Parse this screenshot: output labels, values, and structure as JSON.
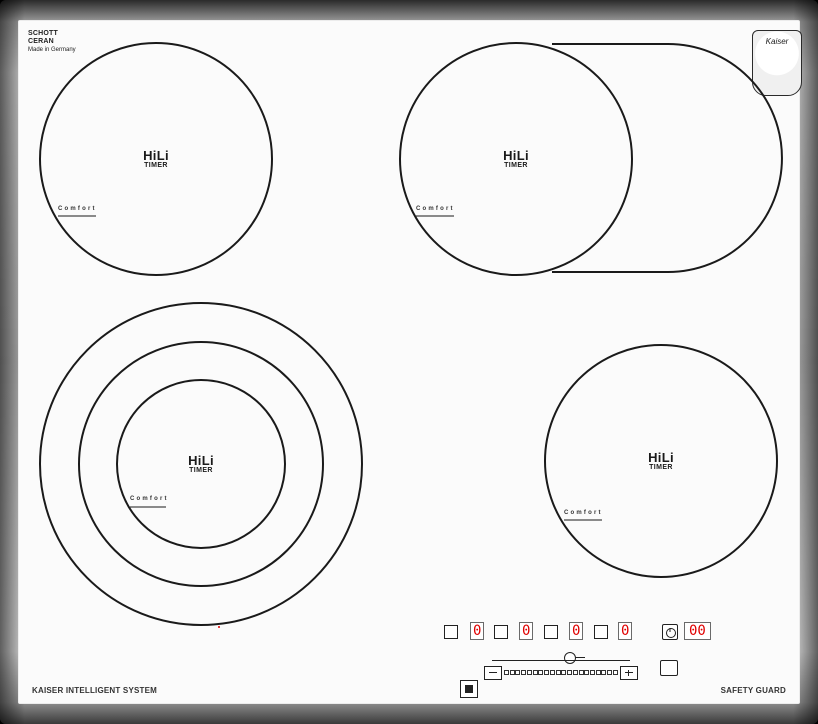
{
  "brand": {
    "schott": "SCHOTT\nCERAN",
    "made_in": "Made in Germany",
    "crest_text": "Kaiser"
  },
  "zones": [
    {
      "id": "front-left",
      "hili": "HiLi",
      "timer": "TIMER",
      "comfort": "Comfort"
    },
    {
      "id": "rear-left",
      "hili": "HiLi",
      "timer": "TIMER",
      "comfort": "Comfort"
    },
    {
      "id": "rear-right",
      "hili": "HiLi",
      "timer": "TIMER",
      "comfort": "Comfort"
    },
    {
      "id": "front-right",
      "hili": "HiLi",
      "timer": "TIMER",
      "comfort": "Comfort"
    }
  ],
  "controls": {
    "zone_displays": [
      "0",
      "0",
      "0",
      "0"
    ],
    "timer_display": "00"
  },
  "footer": {
    "left": "KAISER INTELLIGENT SYSTEM",
    "right": "SAFETY GUARD"
  },
  "accent_colors": {
    "display_red": "#e00000",
    "line_dark": "#1a1a1a",
    "frame_silver": "#c7c7c7"
  }
}
